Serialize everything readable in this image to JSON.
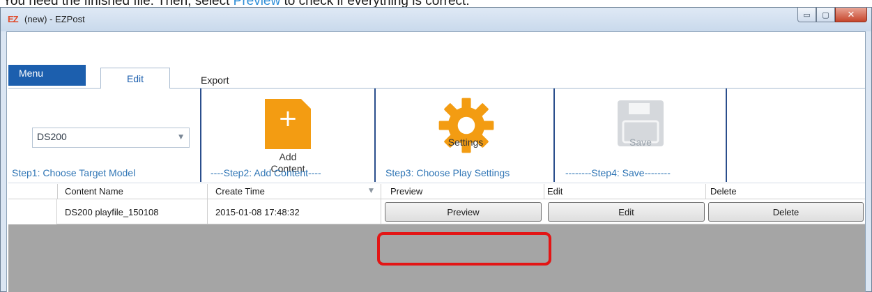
{
  "doc_text": {
    "prefix": "You need the finished file. Then, select ",
    "highlight": "Preview",
    "suffix": " to check if everything is correct."
  },
  "window": {
    "app_icon": "EZ",
    "title": "(new) - EZPost",
    "minimize": "▭",
    "maximize": "▢",
    "close": "✕"
  },
  "ribbon": {
    "tabs": {
      "menu": "Menu",
      "edit": "Edit",
      "export": "Export"
    },
    "step1": {
      "model_value": "DS200",
      "label": "Step1: Choose Target Model"
    },
    "step2": {
      "button_line1": "Add",
      "button_line2": "Content",
      "label": "----Step2: Add Content----"
    },
    "step3": {
      "button": "Settings",
      "label": "Step3: Choose Play Settings"
    },
    "step4": {
      "button": "Save",
      "label": "--------Step4: Save--------"
    }
  },
  "grid": {
    "columns": [
      "Content Name",
      "Create Time",
      "Preview",
      "Edit",
      "Delete"
    ],
    "rows": [
      {
        "content_name": "DS200 playfile_150108",
        "create_time": "2015-01-08 17:48:32",
        "preview": "Preview",
        "edit": "Edit",
        "delete": "Delete"
      }
    ]
  },
  "colors": {
    "accent_blue": "#1c5fae",
    "step_label": "#2f75b5",
    "add_icon": "#f39c12",
    "highlight": "#e31515"
  }
}
